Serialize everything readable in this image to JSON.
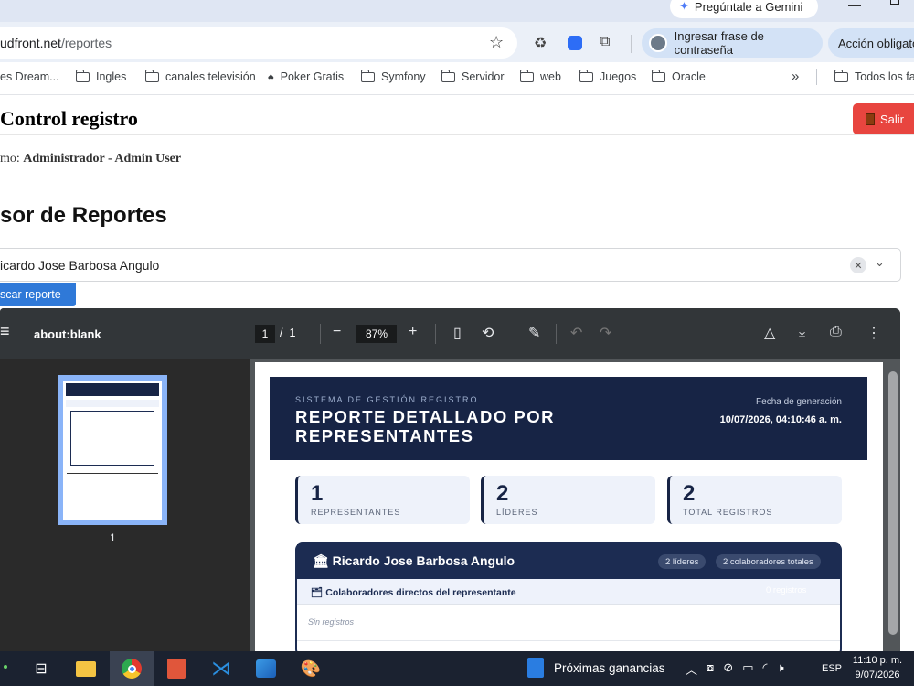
{
  "browser": {
    "gemini_label": "Pregúntale a Gemini",
    "url_host": "udfront.net",
    "url_path": "/reportes",
    "passphrase_button": "Ingresar frase de contraseña",
    "action_button": "Acción obligatoria",
    "bookmarks": [
      "es Dream...",
      "Ingles",
      "canales televisión",
      "Poker Gratis",
      "Symfony",
      "Servidor",
      "web",
      "Juegos",
      "Oracle",
      "Todos los favoritos"
    ]
  },
  "page": {
    "title": "Control registro",
    "logout_label": "Salir",
    "user_prefix": "mo:",
    "user_name": "Administrador - Admin User",
    "section_title": "sor de Reportes",
    "select_value": "icardo Jose Barbosa Angulo",
    "search_button": "scar reporte"
  },
  "viewer": {
    "title": "about:blank",
    "page_current": "1",
    "page_sep": "/",
    "page_total": "1",
    "zoom": "87%",
    "thumb_label": "1",
    "icons": [
      "menu-icon",
      "zoom-out-icon",
      "zoom-in-icon",
      "fit-page-icon",
      "rotate-icon",
      "annotate-icon",
      "undo-icon",
      "redo-icon",
      "drive-icon",
      "download-icon",
      "print-icon",
      "more-icon"
    ]
  },
  "report": {
    "kicker": "SISTEMA DE GESTIÓN REGISTRO",
    "title": "REPORTE DETALLADO POR REPRESENTANTES",
    "generated_label": "Fecha de generación",
    "generated_value": "10/07/2026, 04:10:46 a. m.",
    "stats": [
      {
        "value": "1",
        "label": "REPRESENTANTES"
      },
      {
        "value": "2",
        "label": "LÍDERES"
      },
      {
        "value": "2",
        "label": "TOTAL REGISTROS"
      }
    ],
    "card_name": "Ricardo Jose Barbosa Angulo",
    "card_pill_1": "2 líderes",
    "card_pill_2": "2 colaboradores totales",
    "card_sub_title": "Colaboradores directos del representante",
    "card_sub_badge": "0 registros",
    "card_empty": "Sin registros"
  },
  "taskbar": {
    "news": "Próximas ganancias",
    "lang": "ESP",
    "time": "11:10 p. m.",
    "date": "9/07/2026"
  },
  "colors": {
    "accent": "#2f79d8",
    "danger": "#e8453f",
    "navy": "#172445"
  }
}
